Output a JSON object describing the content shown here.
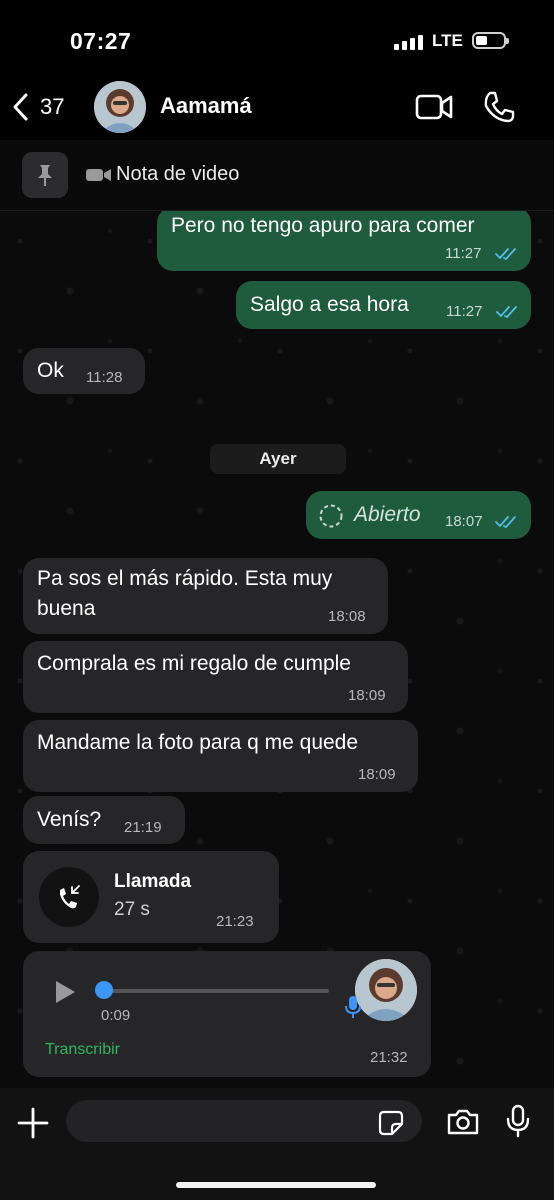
{
  "status_bar": {
    "time": "07:27",
    "network": "LTE"
  },
  "header": {
    "back_count": "37",
    "contact_name": "Aamamá"
  },
  "pinned": {
    "label": "Nota de video"
  },
  "messages": [
    {
      "text": "Pero no tengo apuro para comer",
      "time": "11:27",
      "direction": "out"
    },
    {
      "text": "Salgo a esa hora",
      "time": "11:27",
      "direction": "out"
    },
    {
      "text": "Ok",
      "time": "11:28",
      "direction": "in"
    },
    {
      "text": "Abierto",
      "time": "18:07",
      "direction": "out"
    },
    {
      "text": "Pa sos el más rápido. Esta muy buena",
      "line1": "Pa sos el más rápido. Esta muy",
      "line2": "buena",
      "time": "18:08",
      "direction": "in"
    },
    {
      "text": "Comprala es mi regalo de cumple",
      "time": "18:09",
      "direction": "in"
    },
    {
      "text": "Mandame la foto para q me quede",
      "time": "18:09",
      "direction": "in"
    },
    {
      "text": "Venís?",
      "time": "21:19",
      "direction": "in"
    }
  ],
  "date_divider": "Ayer",
  "call": {
    "title": "Llamada",
    "duration": "27 s",
    "time": "21:23"
  },
  "voice_note": {
    "duration": "0:09",
    "transcribe_label": "Transcribir",
    "time": "21:32",
    "progress": 0.0
  },
  "colors": {
    "outgoing_bubble": "#1f5c3e",
    "incoming_bubble": "#262628",
    "read_ticks": "#53bdeb",
    "accent_green": "#2fb660",
    "voice_knob": "#3c96f5"
  },
  "icons": [
    "back-chevron-icon",
    "video-call-icon",
    "phone-icon",
    "pin-icon",
    "video-note-icon",
    "double-check-icon",
    "incoming-call-icon",
    "play-icon",
    "mic-icon",
    "plus-icon",
    "sticker-icon",
    "camera-icon"
  ]
}
